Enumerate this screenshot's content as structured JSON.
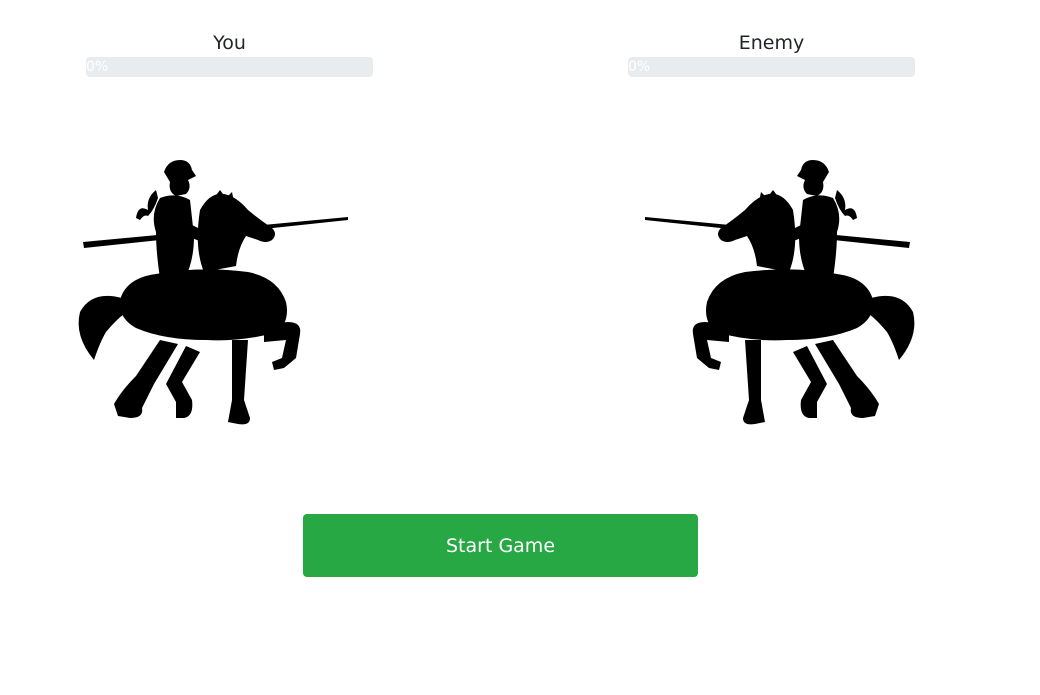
{
  "player": {
    "name": "You",
    "progress": 0,
    "progress_label": "0%"
  },
  "enemy": {
    "name": "Enemy",
    "progress": 0,
    "progress_label": "0%"
  },
  "start_button_label": "Start Game",
  "icons": {
    "player_knight": "knight-on-horse-icon",
    "enemy_knight": "knight-on-horse-icon"
  },
  "colors": {
    "button_bg": "#28a745",
    "progress_track": "#e9ecef",
    "progress_fill": "#007bff",
    "silhouette": "#000000"
  }
}
